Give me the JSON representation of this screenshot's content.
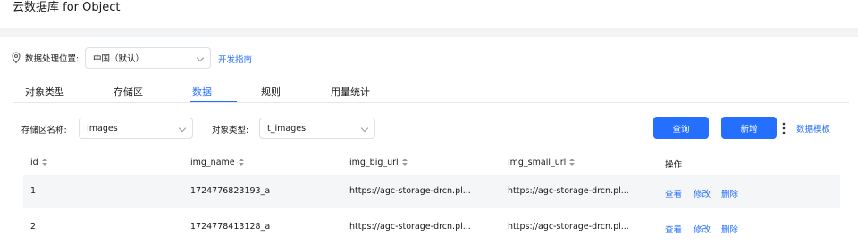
{
  "header": {
    "title": "云数据库 for Object"
  },
  "location": {
    "label": "数据处理位置:",
    "value": "中国（默认）",
    "dev_guide_link": "开发指南"
  },
  "tabs": [
    {
      "label": "对象类型"
    },
    {
      "label": "存储区"
    },
    {
      "label": "数据"
    },
    {
      "label": "规则"
    },
    {
      "label": "用量统计"
    }
  ],
  "filters": {
    "zone_label": "存储区名称:",
    "zone_value": "Images",
    "type_label": "对象类型:",
    "type_value": "t_images"
  },
  "toolbar": {
    "query_label": "查询",
    "add_label": "新增",
    "template_link": "数据模板"
  },
  "table": {
    "columns": [
      "id",
      "img_name",
      "img_big_url",
      "img_small_url",
      "操作"
    ],
    "rows": [
      {
        "id": "1",
        "img_name": "1724776823193_a",
        "img_big_url": "https://agc-storage-drcn.pl...",
        "img_small_url": "https://agc-storage-drcn.pl...",
        "view": "查看",
        "edit": "修改",
        "delete": "删除"
      },
      {
        "id": "2",
        "img_name": "1724778413128_a",
        "img_big_url": "https://agc-storage-drcn.pl...",
        "img_small_url": "https://agc-storage-drcn.pl...",
        "view": "查看",
        "edit": "修改",
        "delete": "删除"
      }
    ]
  },
  "colors": {
    "accent": "#256fff",
    "row_stripe": "#f5f6f7",
    "page_gap": "#f2f3f5"
  },
  "icons": {
    "location": "location-pin-icon",
    "more": "more-vertical-icon"
  }
}
